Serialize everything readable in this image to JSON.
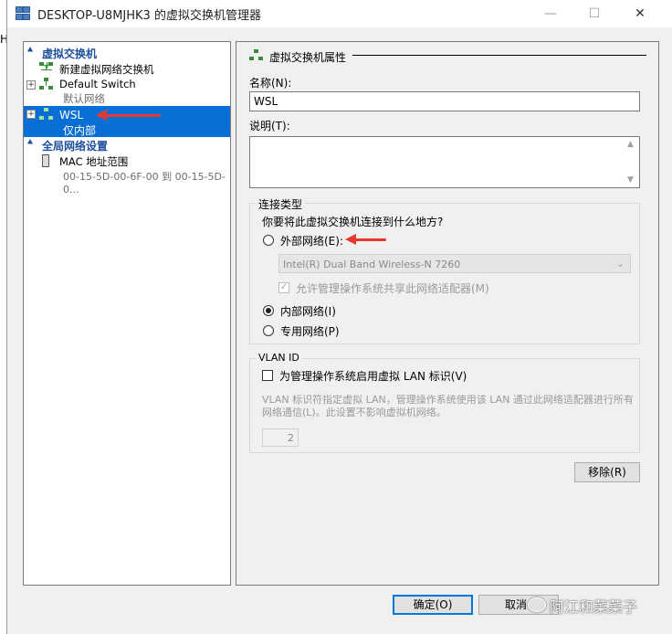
{
  "window": {
    "title": "DESKTOP-U8MJHK3 的虚拟交换机管理器",
    "controls": {
      "minimize": "—",
      "maximize": "☐",
      "close": "✕"
    }
  },
  "background_fragment": "H",
  "tree": {
    "virtual_switches_header": "虚拟交换机",
    "items": [
      {
        "label": "新建虚拟网络交换机"
      },
      {
        "label": "Default Switch",
        "sublabel": "默认网络",
        "expander": "+"
      },
      {
        "label": "WSL",
        "sublabel": "仅内部",
        "expander": "+"
      }
    ],
    "global_header": "全局网络设置",
    "mac_item": {
      "label": "MAC 地址范围",
      "sublabel": "00-15-5D-00-6F-00 到 00-15-5D-0..."
    }
  },
  "properties": {
    "group_title": "虚拟交换机属性",
    "name_label": "名称(N):",
    "name_value": "WSL",
    "notes_label": "说明(T):",
    "connection_type": {
      "legend": "连接类型",
      "question": "你要将此虚拟交换机连接到什么地方?",
      "external_label": "外部网络(E):",
      "adapter": "Intel(R) Dual Band Wireless-N 7260",
      "allow_mgmt_label": "允许管理操作系统共享此网络适配器(M)",
      "internal_label": "内部网络(I)",
      "private_label": "专用网络(P)",
      "selected": "internal"
    },
    "vlan": {
      "legend": "VLAN ID",
      "enable_label": "为管理操作系统启用虚拟 LAN 标识(V)",
      "description": "VLAN 标识符指定虚拟 LAN，管理操作系统使用该 LAN 通过此网络适配器进行所有网络通信(L)。此设置不影响虚拟机网络。",
      "vlan_id": "2"
    },
    "remove_button": "移除(R)"
  },
  "footer": {
    "ok_button": "确定(O)",
    "cancel_button": "取消"
  },
  "watermark": "阿江和菜菜子",
  "colors": {
    "selection": "#0a6fd5",
    "section_header": "#1e4f9e",
    "annotation_arrow": "#e8372c"
  }
}
